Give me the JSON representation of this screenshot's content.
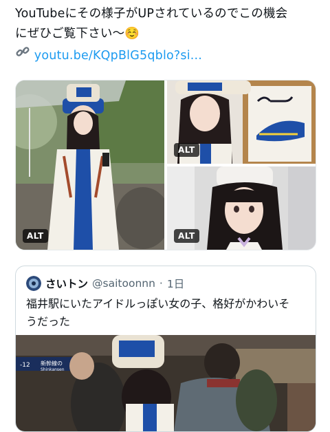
{
  "tweet": {
    "lines": [
      "YouTubeにその様子がUPされているのでこの機会",
      "にぜひご覧下さい〜☺️"
    ],
    "link_icon": "link-icon",
    "link_text": "youtu.be/KQpBlG5qblo?si..."
  },
  "media": [
    {
      "alt_label": "ALT"
    },
    {
      "alt_label": "ALT"
    },
    {
      "alt_label": "ALT"
    }
  ],
  "quote": {
    "author_name": "さいトン",
    "author_handle": "@saitoonnn",
    "separator": "·",
    "time": "1日",
    "lines": [
      "福井駅にいたアイドルっぽい女の子、格好がかわいそ",
      "うだった"
    ],
    "sign_text": "新幹線の",
    "sign_sub": "Shinkansen",
    "sign_number": "-12"
  },
  "colors": {
    "link": "#1d9bf0",
    "text": "#0f1419",
    "muted": "#536471"
  }
}
